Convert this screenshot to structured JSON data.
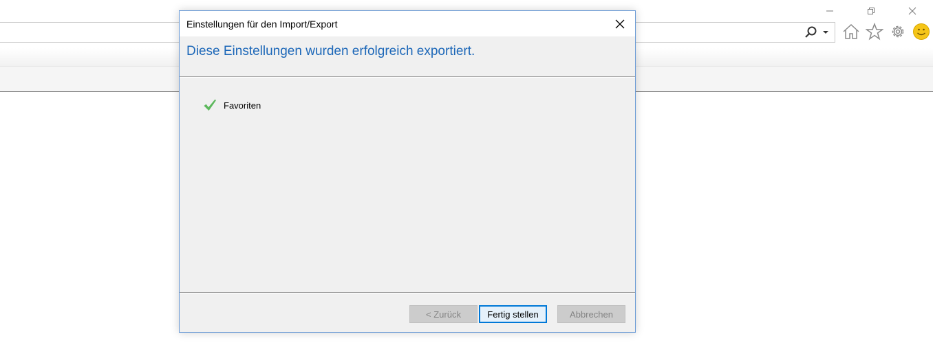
{
  "browser": {
    "window_controls": [
      {
        "name": "minimize-button",
        "icon": "minimize-icon"
      },
      {
        "name": "restore-button",
        "icon": "restore-icon"
      },
      {
        "name": "close-window-button",
        "icon": "close-icon"
      }
    ],
    "address_bar": {
      "value": "",
      "search_icon": "search-icon",
      "dropdown_icon": "chevron-down-icon"
    },
    "toolbar_icons": [
      "home-icon",
      "star-icon",
      "gear-icon",
      "smiley-icon"
    ]
  },
  "dialog": {
    "title": "Einstellungen für den Import/Export",
    "heading": "Diese Einstellungen wurden erfolgreich exportiert.",
    "items": [
      {
        "label": "Favoriten",
        "status_icon": "checkmark-icon"
      }
    ],
    "buttons": {
      "back": {
        "label": "< Zurück",
        "enabled": false
      },
      "finish": {
        "label": "Fertig stellen",
        "enabled": true,
        "default": true
      },
      "cancel": {
        "label": "Abbrechen",
        "enabled": false
      }
    }
  },
  "colors": {
    "heading": "#1c67b8",
    "check": "#5cb85c",
    "default_button_border": "#0078d7",
    "smiley": "#f5c518"
  }
}
